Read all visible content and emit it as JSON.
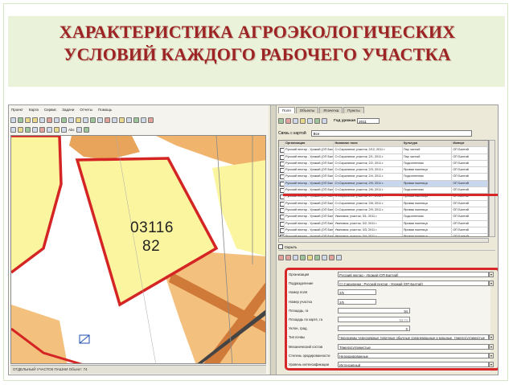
{
  "slide": {
    "title_line1": "ХАРАКТЕРИСТИКА АГРОЭКОЛОГИЧЕСКИХ",
    "title_line2": "УСЛОВИЙ КАЖДОГО РАБОЧЕГО УЧАСТКА"
  },
  "colors": {
    "title": "#9c2424",
    "highlight_red": "#d62828",
    "field_fill": "#fbf59f",
    "map_orange": "#f0b46c"
  },
  "gis": {
    "menu": [
      "Проект",
      "Карта",
      "Сервис",
      "Задачи",
      "Отчеты",
      "Помощь"
    ],
    "toolbar2_text": "Abc",
    "map_label_line1": "03116",
    "map_label_line2": "82",
    "status": "ОТДЕЛЬНЫЙ УЧАСТОК ПАШНИ Объект: 74"
  },
  "panel": {
    "tabs": [
      "Поля",
      "Объекты",
      "Ятачетка",
      "Пункты"
    ],
    "year_label": "Год урожая",
    "year_value": "2011",
    "link_label": "Связь с картой",
    "link_value": "Все",
    "hide_label": "Скрыть",
    "table": {
      "headers": [
        "Организация",
        "Название поля",
        "Культура",
        "Импорт"
      ],
      "rows": [
        [
          "Русский пектар - Урожай (ОП Балтай)",
          "Ст.Саралинки; участок; 2/12; 2011 г.",
          "Пар чистый",
          "ОП Балтай"
        ],
        [
          "Русский пектар - Урожай (ОП Балтай)",
          "Ст.Саралинки; участок; 2/1; 2011 г.",
          "Пар чистый",
          "ОП Балтай"
        ],
        [
          "Русский пектар - Урожай (ОП Балтай)",
          "Ст.Саралинки; участок; 2/2; 2011 г.",
          "Подсолнечник",
          "ОП Балтай"
        ],
        [
          "Русский пектар - Урожай (ОП Балтай)",
          "Ст.Саралинки; участок; 2/3; 2011 г.",
          "Яровая пшеница",
          "ОП Балтай"
        ],
        [
          "Русский пектар - Урожай (ОП Балтай)",
          "Ст.Саралинки; участок; 2/4; 2011 г.",
          "Подсолнечник",
          "ОП Балтай"
        ],
        [
          "Русский пектар - Урожай (ОП Балтай)",
          "Ст.Саралинки; участок; 2/5; 2011 г.",
          "Яровая пшеница",
          "ОП Балтай"
        ],
        [
          "Русский пектар - Урожай (ОП Балтай)",
          "Ст.Саралинки; участок; 2/6; 2011 г.",
          "Подсолнечник",
          "ОП Балтай"
        ],
        [
          "Русский пектар - Урожай (ОП Балтай)",
          "Ст.Саралинки; участок; 2/7; 2011 г.",
          "Яровая пшеница",
          "ОП Балтай"
        ],
        [
          "Русский пектар - Урожай (ОП Балтай)",
          "Ст.Саралинки; участок; 2/8; 2011 г.",
          "Яровая пшеница",
          "ОП Балтай"
        ],
        [
          "Русский пектар - Урожай (ОП Балтай)",
          "Ст.Саралинки; участок; 2/9; 2011 г.",
          "Яровая пшеница",
          "ОП Балтай"
        ],
        [
          "Русский пектар - Урожай (ОП Балтай)",
          "Уваловка; участок; 3/1; 2011 г.",
          "Подсолнечник",
          "ОП Балтай"
        ],
        [
          "Русский пектар - Урожай (ОП Балтай)",
          "Уваловка; участок; 3/2; 2011 г.",
          "Яровая пшеница",
          "ОП Балтай"
        ],
        [
          "Русский пектар - Урожай (ОП Балтай)",
          "Уваловка; участок; 3/3; 2011 г.",
          "Яровая пшеница",
          "ОП Балтай"
        ],
        [
          "Русский пектар - Урожай (ОП Балтай)",
          "Уваловка; участок; 3/4; 2011 г.",
          "Яровая пшеница",
          "ОП Балтай"
        ]
      ]
    },
    "form": [
      {
        "label": "Организация",
        "value": "Русский пектар - Урожай (ОП Балтай)",
        "dropdown": true
      },
      {
        "label": "Подразделение",
        "value": "Ст.Саралинки : Русский пектар - Урожай (ОП Балтай)",
        "dropdown": true
      },
      {
        "label": "Номер поля",
        "value": "2/5",
        "dropdown": false
      },
      {
        "label": "Номер участка",
        "value": "2/5",
        "dropdown": false
      },
      {
        "label": "Площадь, га",
        "value": "94",
        "dropdown": false
      },
      {
        "label": "Площадь по карте, га",
        "value": "93.74",
        "dropdown": false
      },
      {
        "label": "Уклон, град.",
        "value": "0",
        "dropdown": false
      },
      {
        "label": "Тип почвы",
        "value": "Черноземы черноземные типичные обычные среднемощные и мощные, тяжелосуглинистые",
        "dropdown": true
      },
      {
        "label": "Механический состав",
        "value": "Тяжелосуглинистые",
        "dropdown": true
      },
      {
        "label": "Степень эродированности",
        "value": "Неэродированные",
        "dropdown": true
      },
      {
        "label": "Уровень интенсификации",
        "value": "Интенсивный",
        "dropdown": true
      }
    ]
  }
}
